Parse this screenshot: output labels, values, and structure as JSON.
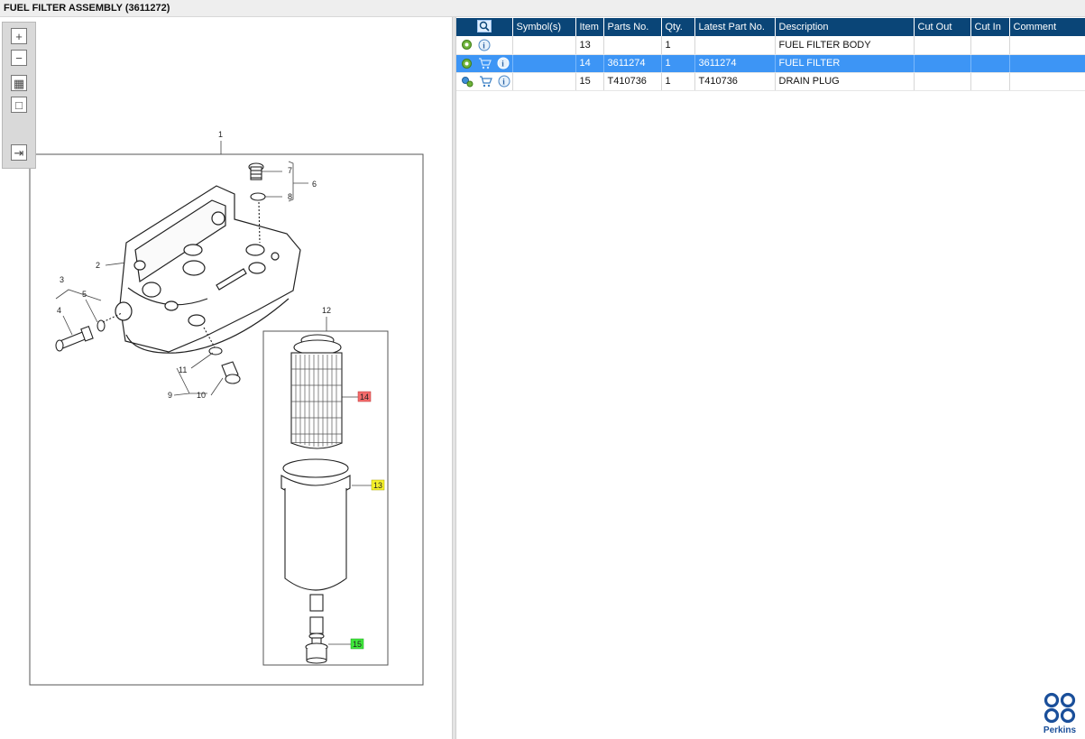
{
  "window": {
    "title": "FUEL FILTER ASSEMBLY (3611272)"
  },
  "toolbar": {
    "buttons": [
      {
        "name": "zoom-in",
        "glyph": "+"
      },
      {
        "name": "zoom-out",
        "glyph": "−"
      },
      {
        "name": "fit-all",
        "glyph": "▦"
      },
      {
        "name": "actual-size",
        "glyph": "□"
      },
      {
        "name": "toggle-panel",
        "glyph": "⇥"
      }
    ]
  },
  "diagram": {
    "callouts": {
      "c1": "1",
      "c2": "2",
      "c3": "3",
      "c4": "4",
      "c5": "5",
      "c6": "6",
      "c7": "7",
      "c8": "8",
      "c9": "9",
      "c10": "10",
      "c11": "11",
      "c12": "12",
      "c13": "13",
      "c14": "14",
      "c15": "15"
    },
    "highlight_colors": {
      "14": "#f36b6b",
      "13": "#f6f22a",
      "15": "#3fe83b"
    }
  },
  "table": {
    "headers": {
      "symbols": "Symbol(s)",
      "item": "Item",
      "parts_no": "Parts No.",
      "qty": "Qty.",
      "latest": "Latest Part No.",
      "description": "Description",
      "cut_out": "Cut Out",
      "cut_in": "Cut In",
      "comment": "Comment"
    },
    "rows": [
      {
        "item": "13",
        "parts_no": "",
        "qty": "1",
        "latest": "",
        "description": "FUEL FILTER BODY",
        "cut_out": "",
        "cut_in": "",
        "comment": "",
        "icons": [
          "gear-icon",
          "info-icon"
        ]
      },
      {
        "item": "14",
        "parts_no": "3611274",
        "qty": "1",
        "latest": "3611274",
        "description": "FUEL FILTER",
        "cut_out": "",
        "cut_in": "",
        "comment": "",
        "icons": [
          "gear-icon",
          "cart-icon",
          "info-icon"
        ]
      },
      {
        "item": "15",
        "parts_no": "T410736",
        "qty": "1",
        "latest": "T410736",
        "description": "DRAIN PLUG",
        "cut_out": "",
        "cut_in": "",
        "comment": "",
        "icons": [
          "gears-icon",
          "cart-icon",
          "info-icon"
        ]
      }
    ],
    "selected_row": 1
  },
  "brand": {
    "name": "Perkins",
    "color": "#1a4f9a"
  },
  "colors": {
    "header_bg": "#0a4577",
    "selected_bg": "#3d95f5"
  }
}
